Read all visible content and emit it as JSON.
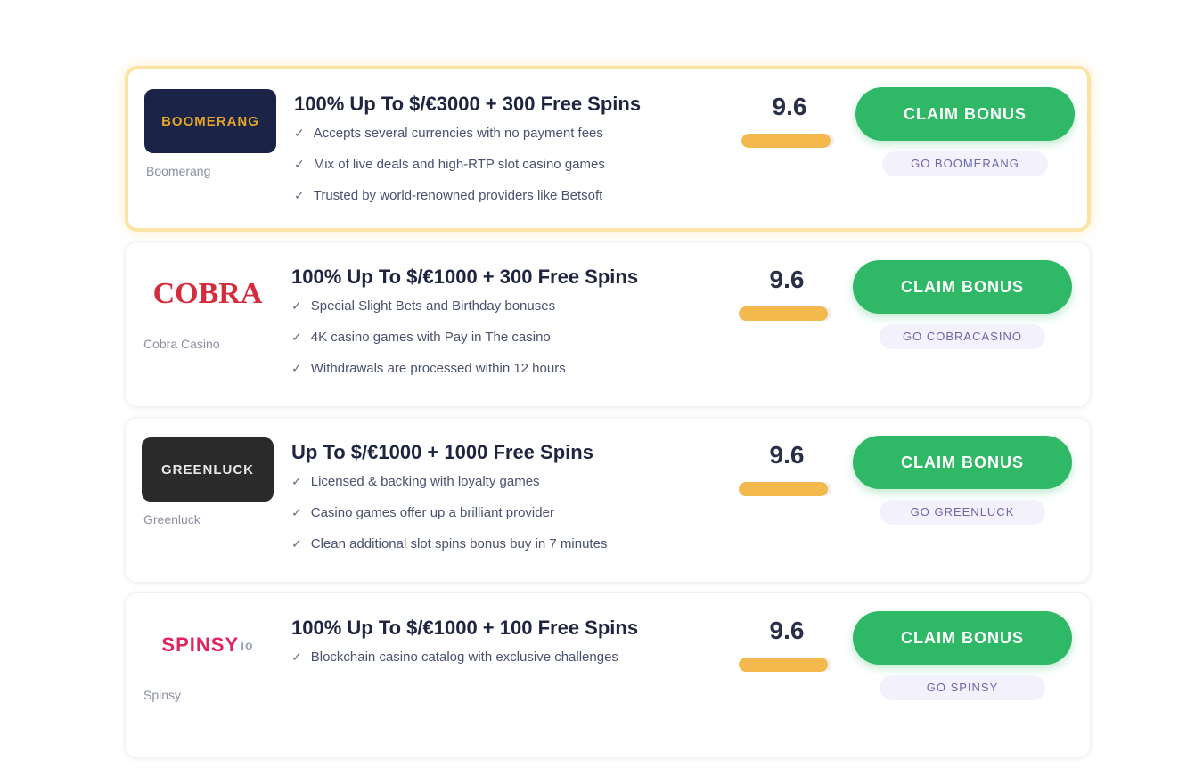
{
  "offers": [
    {
      "brand": "Boomerang",
      "logo_text": "BOOMERANG",
      "title": "100% Up To $/€3000 + 300 Free Spins",
      "features": [
        "Accepts several currencies with no payment fees",
        "Mix of live deals and high-RTP slot casino games",
        "Trusted by world-renowned providers like Betsoft"
      ],
      "score": "9.6",
      "rating_fraction": 0.96,
      "claim_label": "CLAIM BONUS",
      "review_label": "GO BOOMERANG"
    },
    {
      "brand": "Cobra Casino",
      "logo_text": "COBRA",
      "title": "100% Up To $/€1000 + 300 Free Spins",
      "features": [
        "Special Slight Bets and Birthday bonuses",
        "4K casino games with Pay in The casino",
        "Withdrawals are processed within 12 hours"
      ],
      "score": "9.6",
      "rating_fraction": 0.96,
      "claim_label": "CLAIM BONUS",
      "review_label": "GO COBRACASINO"
    },
    {
      "brand": "Greenluck",
      "logo_text": "GREENLUCK",
      "title": "Up To $/€1000 + 1000 Free Spins",
      "features": [
        "Licensed & backing with loyalty games",
        "Casino games offer up a brilliant provider",
        "Clean additional slot spins bonus buy in 7 minutes"
      ],
      "score": "9.6",
      "rating_fraction": 0.96,
      "claim_label": "CLAIM BONUS",
      "review_label": "GO GREENLUCK"
    },
    {
      "brand": "Spinsy",
      "logo_text": "SPINSY",
      "logo_tail": "io",
      "title": "100% Up To $/€1000 + 100 Free Spins",
      "features": [
        "Blockchain casino catalog with exclusive challenges"
      ],
      "score": "9.6",
      "rating_fraction": 0.96,
      "claim_label": "CLAIM BONUS",
      "review_label": "GO SPINSY"
    }
  ],
  "colors": {
    "claim_button": "#2fb866",
    "rating_bar": "#f3b94d",
    "featured_border": "#fbe3a6"
  },
  "icons": {
    "feature_bullet": "check-icon",
    "check_glyph": "✓"
  }
}
